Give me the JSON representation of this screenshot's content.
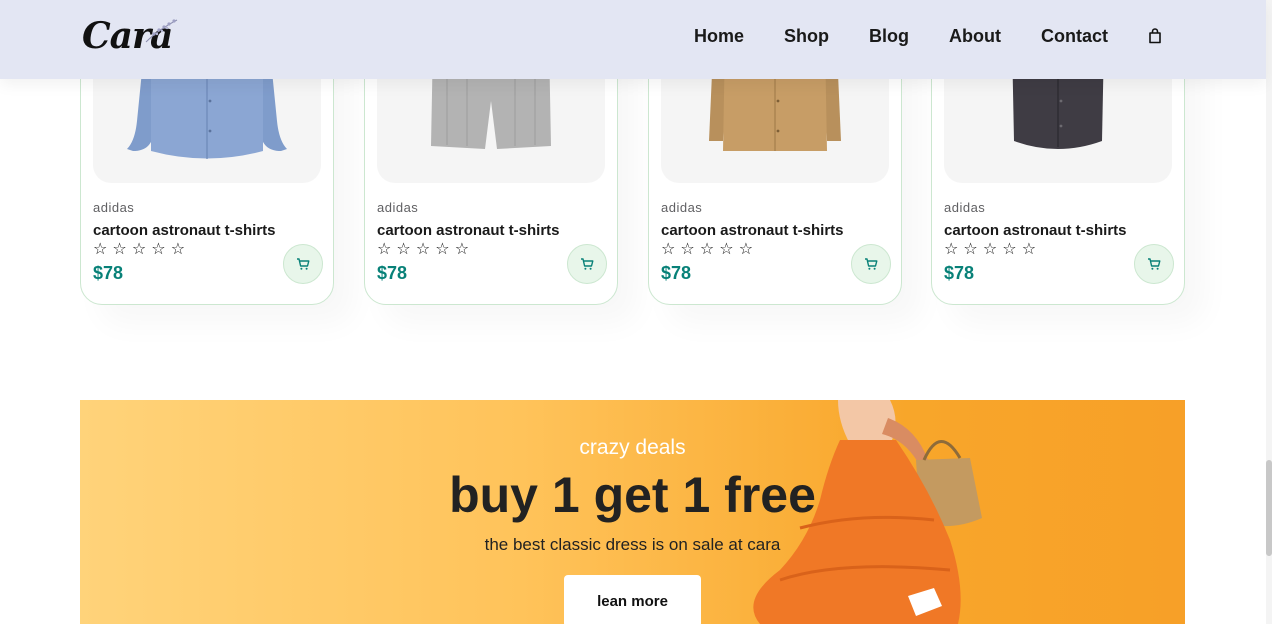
{
  "header": {
    "logo_text": "Cara",
    "nav": [
      {
        "label": "Home"
      },
      {
        "label": "Shop"
      },
      {
        "label": "Blog"
      },
      {
        "label": "About"
      },
      {
        "label": "Contact"
      }
    ],
    "bag_icon": "shopping-bag-icon",
    "background": "#e3e6f3"
  },
  "products": [
    {
      "brand": "adidas",
      "title": "cartoon astronaut t-shirts",
      "rating": 0,
      "stars": "☆ ☆ ☆ ☆ ☆",
      "price": "$78",
      "image": "blue-shirt",
      "cart_icon": "cart-icon"
    },
    {
      "brand": "adidas",
      "title": "cartoon astronaut t-shirts",
      "rating": 0,
      "stars": "☆ ☆ ☆ ☆ ☆",
      "price": "$78",
      "image": "grey-shorts",
      "cart_icon": "cart-icon"
    },
    {
      "brand": "adidas",
      "title": "cartoon astronaut t-shirts",
      "rating": 0,
      "stars": "☆ ☆ ☆ ☆ ☆",
      "price": "$78",
      "image": "tan-shirt",
      "cart_icon": "cart-icon"
    },
    {
      "brand": "adidas",
      "title": "cartoon astronaut t-shirts",
      "rating": 0,
      "stars": "☆ ☆ ☆ ☆ ☆",
      "price": "$78",
      "image": "dark-shirt",
      "cart_icon": "cart-icon"
    }
  ],
  "banner": {
    "subtitle": "crazy deals",
    "title": "buy 1 get 1 free",
    "description": "the best classic dress is on sale at cara",
    "button_label": "lean more"
  },
  "colors": {
    "accent": "#088178",
    "card_border": "#cce7d0",
    "cart_bg": "#e8f6ea"
  }
}
